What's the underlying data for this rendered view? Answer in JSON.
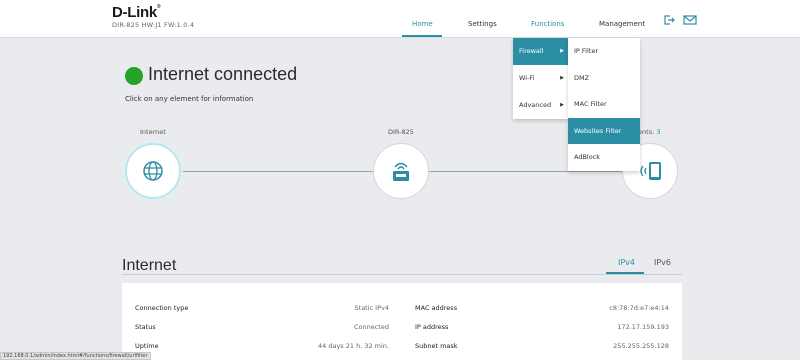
{
  "header": {
    "brand": "D-Link",
    "firmware": "DIR-825 HW:J1 FW:1.0.4",
    "nav": {
      "home": "Home",
      "settings": "Settings",
      "functions": "Functions",
      "management": "Management"
    },
    "icons": [
      "logout-icon",
      "mail-icon"
    ]
  },
  "menu": {
    "level1": [
      "Firewall",
      "Wi-Fi",
      "Advanced"
    ],
    "level2": [
      "IP Filter",
      "DMZ",
      "MAC Filter",
      "Websites Filter",
      "AdBlock"
    ]
  },
  "status": {
    "title": "Internet connected",
    "hint": "Click on any element for information",
    "color": "#27a327"
  },
  "topology": {
    "internet_label": "Internet",
    "router_label": "DIR-825",
    "clients_label": "l clients:",
    "clients_count": "3"
  },
  "internet": {
    "title": "Internet",
    "tabs": [
      "IPv4",
      "IPv6"
    ],
    "left": [
      {
        "label": "Connection type",
        "value": "Static IPv4"
      },
      {
        "label": "Status",
        "value": "Connected"
      },
      {
        "label": "Uptime",
        "value": "44 days 21 h. 32 min."
      }
    ],
    "right": [
      {
        "label": "MAC address",
        "value": "c8:78:7d:e7:e4:14"
      },
      {
        "label": "IP address",
        "value": "172.17.159.193"
      },
      {
        "label": "Subnet mask",
        "value": "255.255.255.128"
      }
    ]
  },
  "statusbar": {
    "url": "192.168.0.1/admin/index.html#/functions/firewall/urlfilter"
  },
  "colors": {
    "accent": "#2b8ea5",
    "background": "#e9ebee"
  }
}
